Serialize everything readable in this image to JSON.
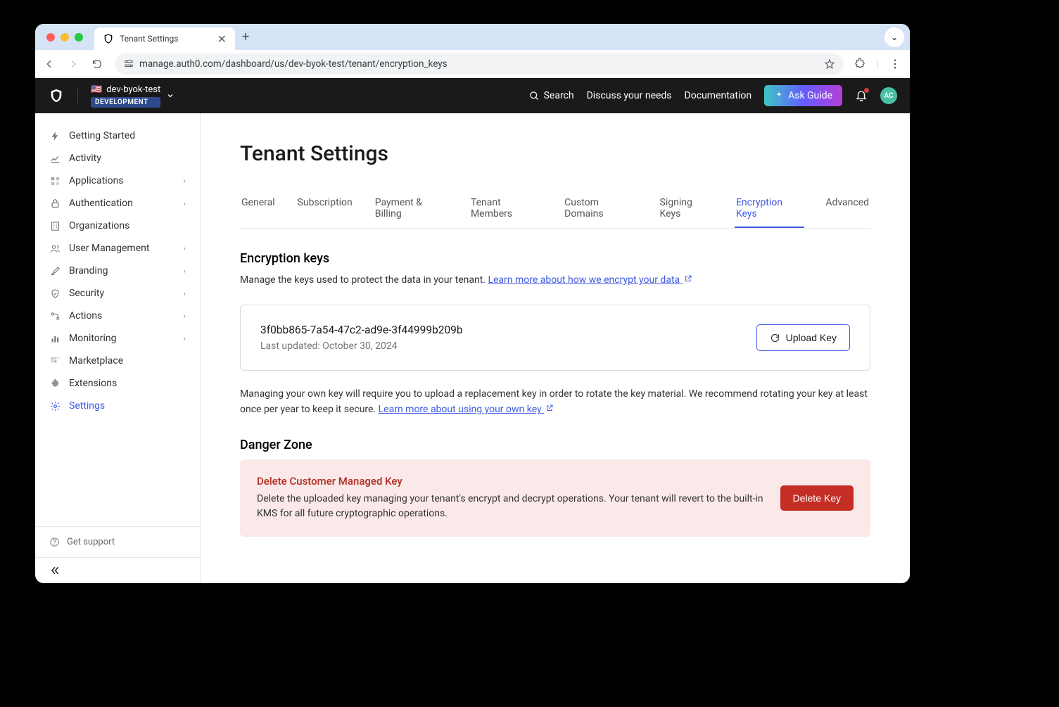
{
  "browser": {
    "tab_title": "Tenant Settings",
    "url": "manage.auth0.com/dashboard/us/dev-byok-test/tenant/encryption_keys"
  },
  "header": {
    "tenant_name": "dev-byok-test",
    "env_badge": "DEVELOPMENT",
    "search": "Search",
    "discuss": "Discuss your needs",
    "documentation": "Documentation",
    "ask_guide": "Ask Guide",
    "avatar_initials": "AC"
  },
  "sidebar": {
    "items": [
      {
        "label": "Getting Started",
        "icon": "bolt",
        "expandable": false
      },
      {
        "label": "Activity",
        "icon": "chart",
        "expandable": false
      },
      {
        "label": "Applications",
        "icon": "apps",
        "expandable": true
      },
      {
        "label": "Authentication",
        "icon": "lock",
        "expandable": true
      },
      {
        "label": "Organizations",
        "icon": "building",
        "expandable": false
      },
      {
        "label": "User Management",
        "icon": "users",
        "expandable": true
      },
      {
        "label": "Branding",
        "icon": "brush",
        "expandable": true
      },
      {
        "label": "Security",
        "icon": "shield",
        "expandable": true
      },
      {
        "label": "Actions",
        "icon": "flow",
        "expandable": true
      },
      {
        "label": "Monitoring",
        "icon": "bars",
        "expandable": true
      },
      {
        "label": "Marketplace",
        "icon": "grid",
        "expandable": false
      },
      {
        "label": "Extensions",
        "icon": "puzzle",
        "expandable": false
      },
      {
        "label": "Settings",
        "icon": "gear",
        "expandable": false,
        "active": true
      }
    ],
    "support": "Get support"
  },
  "page": {
    "title": "Tenant Settings",
    "tabs": [
      "General",
      "Subscription",
      "Payment & Billing",
      "Tenant Members",
      "Custom Domains",
      "Signing Keys",
      "Encryption Keys",
      "Advanced"
    ],
    "active_tab": "Encryption Keys"
  },
  "encryption": {
    "title": "Encryption keys",
    "desc": "Manage the keys used to protect the data in your tenant. ",
    "learn_link1": "Learn more about how we encrypt your data",
    "key_id": "3f0bb865-7a54-47c2-ad9e-3f44999b209b",
    "updated": "Last updated: October 30, 2024",
    "upload_btn": "Upload Key",
    "note": "Managing your own key will require you to upload a replacement key in order to rotate the key material. We recommend rotating your key at least once per year to keep it secure. ",
    "learn_link2": "Learn more about using your own key"
  },
  "danger": {
    "section_title": "Danger Zone",
    "title": "Delete Customer Managed Key",
    "desc": "Delete the uploaded key managing your tenant's encrypt and decrypt operations. Your tenant will revert to the built-in KMS for all future cryptographic operations.",
    "delete_btn": "Delete Key"
  }
}
